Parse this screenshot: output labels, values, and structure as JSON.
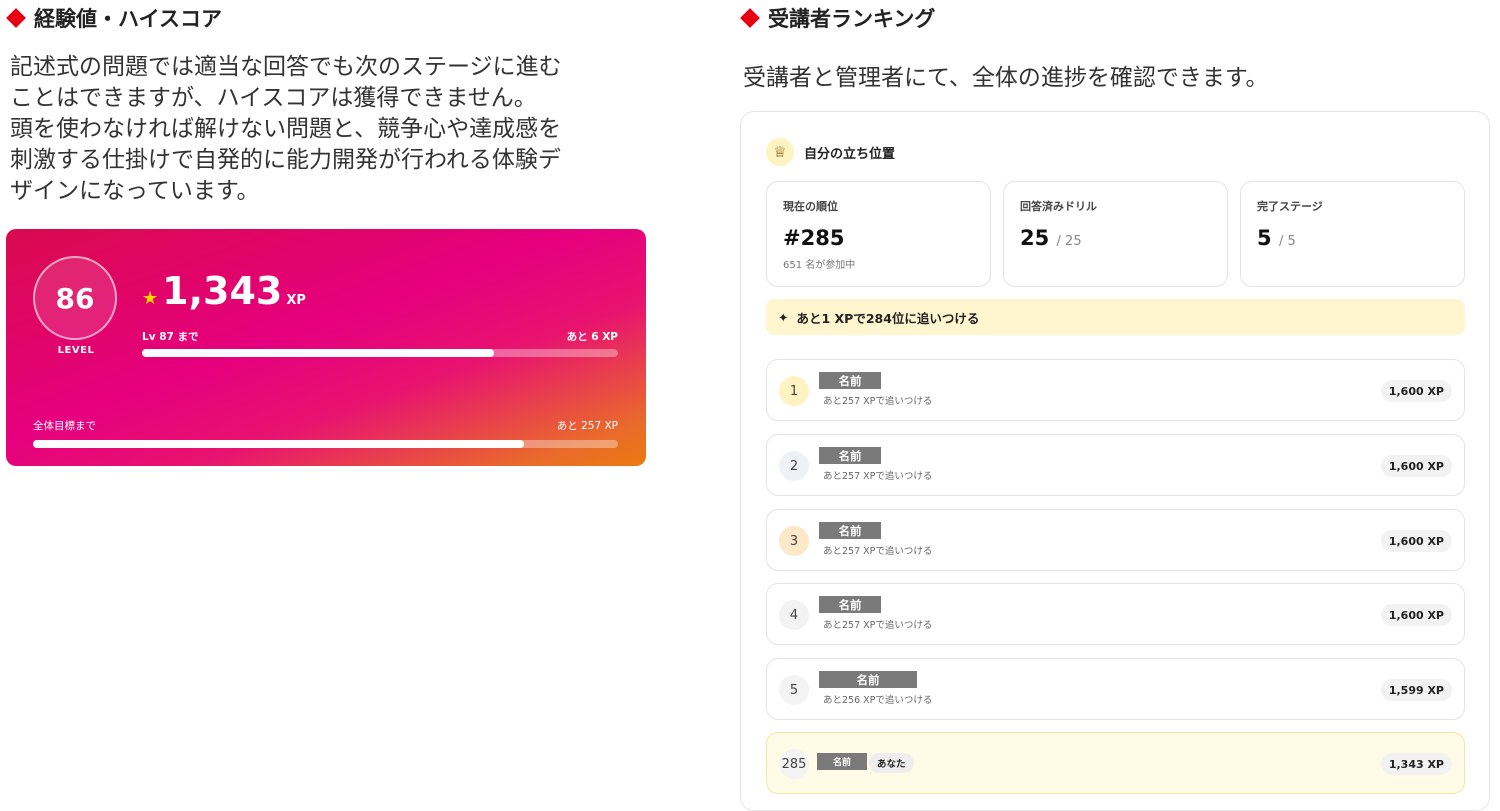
{
  "left": {
    "title": "経験値・ハイスコア",
    "desc_lines": [
      "記述式の問題では適当な回答でも次のステージに進む",
      "ことはできますが、ハイスコアは獲得できません。",
      "頭を使わなければ解けない問題と、競争心や達成感を",
      "刺激する仕掛けで自発的に能力開発が行われる体験デ",
      "ザインになっています。"
    ],
    "card": {
      "level": "86",
      "level_label": "LEVEL",
      "xp": "1,343",
      "xp_unit": "XP",
      "next_label": "Lv 87 まで",
      "next_remaining": "あと 6 XP",
      "next_progress": 0.74,
      "goal_label": "全体目標まで",
      "goal_remaining": "あと 257 XP",
      "goal_progress": 0.84,
      "gradient_start": "#d90a4e",
      "gradient_end": "#ea7a10"
    }
  },
  "right": {
    "title": "受講者ランキング",
    "desc": "受講者と管理者にて、全体の進捗を確認できます。",
    "position_title": "自分の立ち位置",
    "stats": [
      {
        "label": "現在の順位",
        "value": "#285",
        "total": "",
        "sub": "651 名が参加中"
      },
      {
        "label": "回答済みドリル",
        "value": "25",
        "total": "/ 25",
        "sub": ""
      },
      {
        "label": "完了ステージ",
        "value": "5",
        "total": "/ 5",
        "sub": ""
      }
    ],
    "catch_up": "あと1 XPで284位に追いつける",
    "rows": [
      {
        "rank": "1",
        "name": "名前",
        "gap": "あと257 XPで追いつける",
        "xp": "1,600 XP"
      },
      {
        "rank": "2",
        "name": "名前",
        "gap": "あと257 XPで追いつける",
        "xp": "1,600 XP"
      },
      {
        "rank": "3",
        "name": "名前",
        "gap": "あと257 XPで追いつける",
        "xp": "1,600 XP"
      },
      {
        "rank": "4",
        "name": "名前",
        "gap": "あと257 XPで追いつける",
        "xp": "1,600 XP"
      },
      {
        "rank": "5",
        "name": "名前",
        "gap": "あと256 XPで追いつける",
        "xp": "1,599 XP"
      }
    ],
    "me": {
      "rank": "285",
      "name": "名前",
      "badge": "あなた",
      "xp": "1,343 XP"
    },
    "colors": {
      "accent": "#e60012",
      "rank1": "#fff3c4",
      "rank3": "#fde8c8",
      "highlight": "#fffbe6"
    }
  }
}
